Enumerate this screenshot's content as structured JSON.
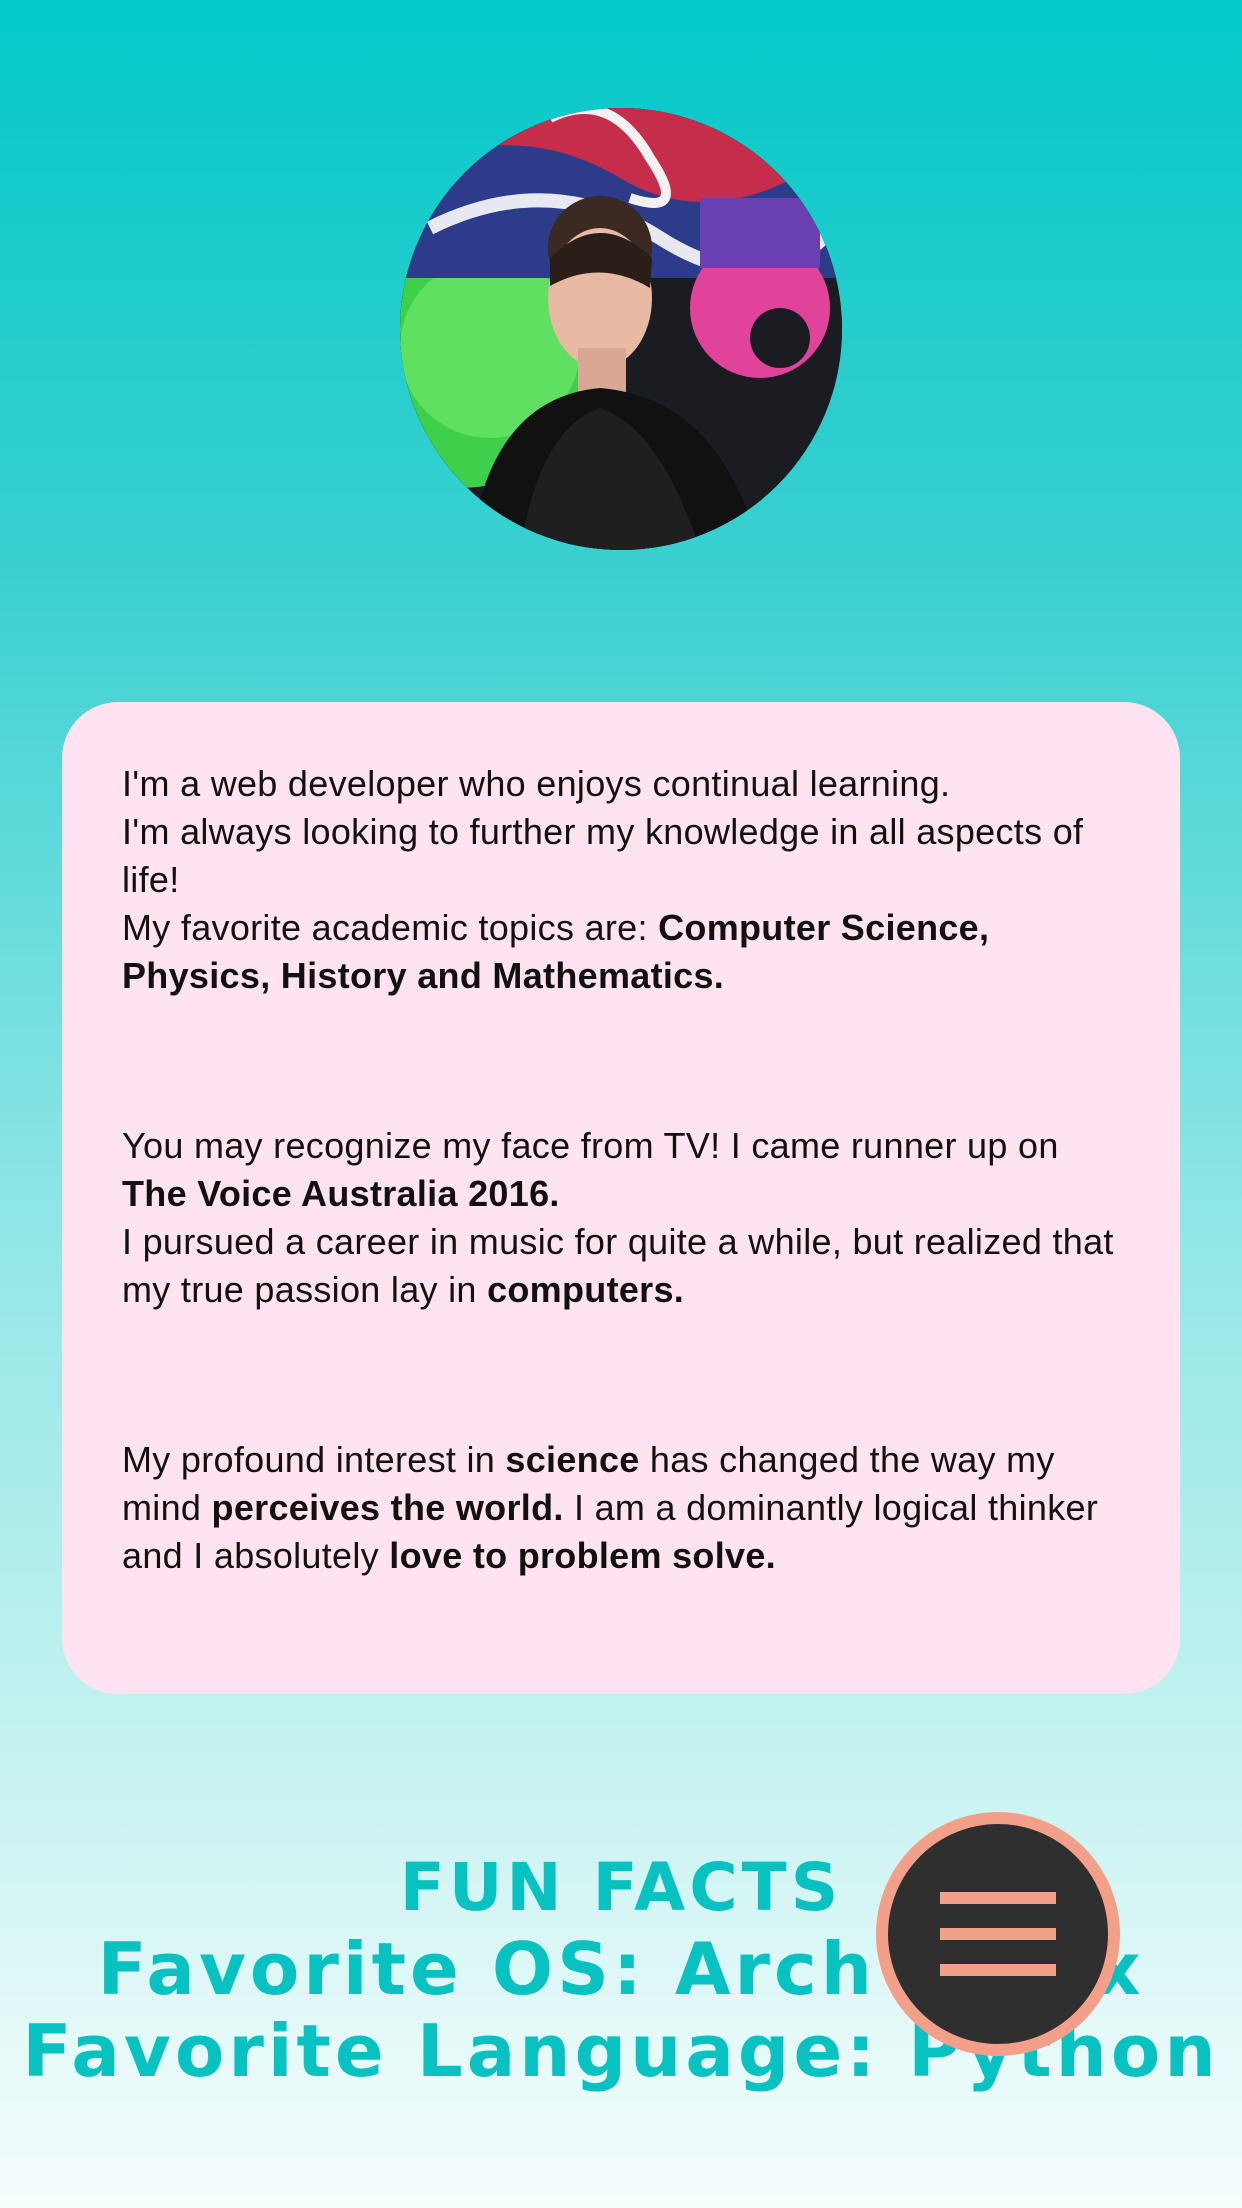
{
  "profile": {
    "photo_icon": "profile-photo"
  },
  "about": {
    "p1": {
      "line1": "I'm a web developer who enjoys continual learning.",
      "line2": "I'm always looking to further my knowledge in all aspects of life!",
      "line3_prefix": "My favorite academic topics are: ",
      "line3_bold": "Computer Science, Physics, History and Mathematics."
    },
    "p2": {
      "prefix": "You may recognize my face from TV! I came runner up on ",
      "bold1": "The Voice Australia 2016.",
      "middle": "I pursued a career in music for quite a while, but realized that my true passion lay in ",
      "bold2": "computers."
    },
    "p3": {
      "t1": "My profound interest in ",
      "b1": "science",
      "t2": " has changed the way my mind ",
      "b2": "perceives the world.",
      "t3": " I am a dominantly logical thinker and I absolutely ",
      "b3": "love to problem solve."
    }
  },
  "fun_facts": {
    "heading": "FUN FACTS",
    "os": "Favorite OS: Arch Linux",
    "language": "Favorite Language: Python"
  },
  "menu": {
    "icon": "hamburger-menu-icon",
    "colors": {
      "ring": "#f3a08b",
      "fill": "#2f2f2f"
    }
  },
  "colors": {
    "accent": "#08c2c2",
    "card": "#ffe3f0"
  }
}
